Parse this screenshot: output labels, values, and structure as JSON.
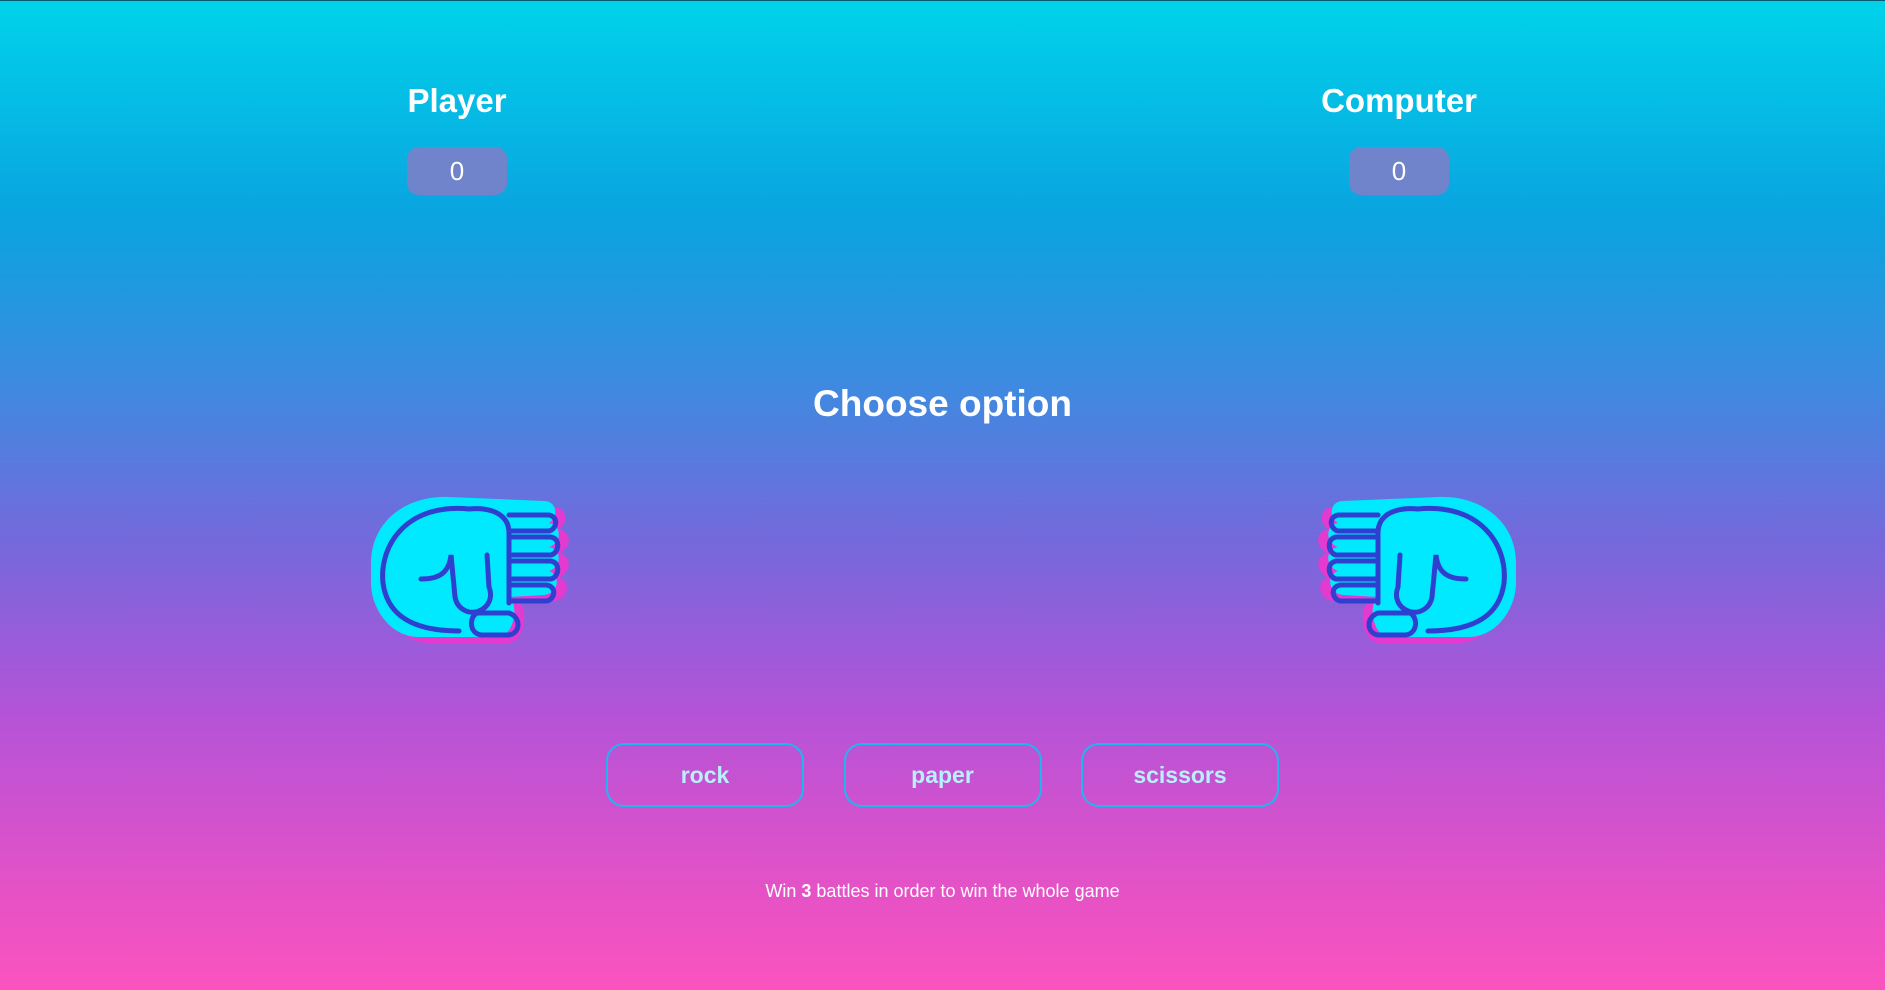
{
  "player": {
    "title": "Player",
    "score": "0"
  },
  "computer": {
    "title": "Computer",
    "score": "0"
  },
  "headline": "Choose option",
  "hands": {
    "player_icon": "rock-fist-icon",
    "computer_icon": "rock-fist-icon"
  },
  "choices": {
    "rock": "rock",
    "paper": "paper",
    "scissors": "scissors"
  },
  "footer": {
    "prefix": "Win ",
    "count": "3",
    "suffix": " battles in order to win the whole game"
  },
  "colors": {
    "gradient_top": "#00d3ea",
    "gradient_bottom": "#fb53be",
    "hand_fill": "#00e9ff",
    "hand_outline": "#2f3fd0",
    "hand_shadow": "#e33ad0",
    "button_border": "#1fb6f0",
    "button_text": "#b9f0ff"
  }
}
